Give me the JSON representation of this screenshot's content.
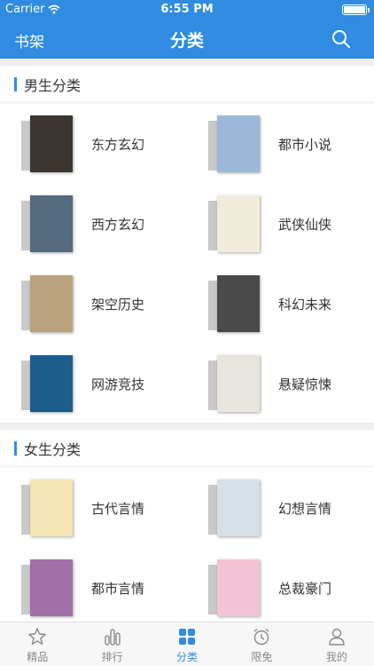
{
  "status_bar": {
    "carrier": "Carrier",
    "time": "6:55 PM"
  },
  "nav": {
    "left": "书架",
    "title": "分类",
    "search_icon": "search-icon"
  },
  "sections": [
    {
      "title": "男生分类",
      "items": [
        {
          "label": "东方玄幻",
          "cover_color": "#3a3530"
        },
        {
          "label": "都市小说",
          "cover_color": "#9db7d8"
        },
        {
          "label": "西方玄幻",
          "cover_color": "#546a7f"
        },
        {
          "label": "武侠仙侠",
          "cover_color": "#f1ecd9"
        },
        {
          "label": "架空历史",
          "cover_color": "#b9a27c"
        },
        {
          "label": "科幻未来",
          "cover_color": "#4a4a4a"
        },
        {
          "label": "网游竞技",
          "cover_color": "#1d5d8a"
        },
        {
          "label": "悬疑惊悚",
          "cover_color": "#e8e4de"
        }
      ]
    },
    {
      "title": "女生分类",
      "items": [
        {
          "label": "古代言情",
          "cover_color": "#f4e3b3"
        },
        {
          "label": "幻想言情",
          "cover_color": "#d7dfe7"
        },
        {
          "label": "都市言情",
          "cover_color": "#a06fa6"
        },
        {
          "label": "总裁豪门",
          "cover_color": "#f2c3d4"
        }
      ]
    }
  ],
  "tabs": [
    {
      "label": "精品",
      "icon": "star-icon",
      "active": false
    },
    {
      "label": "排行",
      "icon": "bar-chart-icon",
      "active": false
    },
    {
      "label": "分类",
      "icon": "grid-icon",
      "active": true
    },
    {
      "label": "限免",
      "icon": "alarm-clock-icon",
      "active": false
    },
    {
      "label": "我的",
      "icon": "person-icon",
      "active": false
    }
  ],
  "colors": {
    "accent": "#2f8ce0",
    "tab_inactive": "#888888"
  }
}
